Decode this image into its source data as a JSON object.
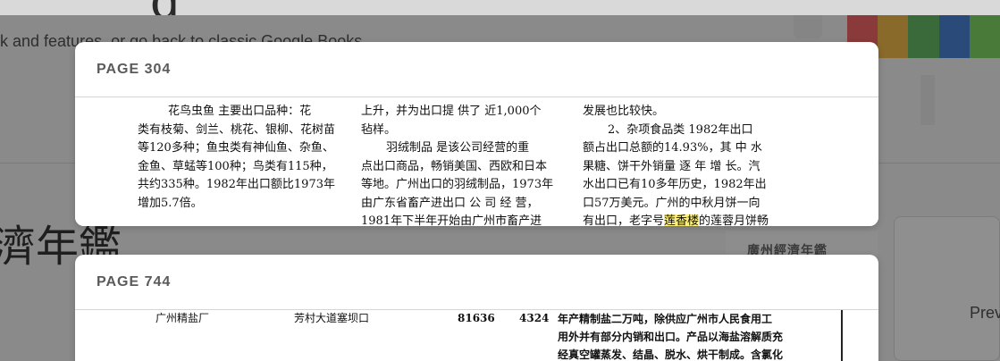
{
  "background": {
    "heading_fragment": "g",
    "link_text": "k and features, or go back to classic Google Books",
    "book_title_fragment": "濟年鑑",
    "book_cover_title": "廣州經濟年鑑",
    "preview_label": "Prev",
    "logo_colors": [
      "#8a3a3a",
      "#8a6a2a",
      "#3a6a3a",
      "#2a4a7a",
      "#4a7a3a"
    ]
  },
  "results": [
    {
      "page_label": "PAGE 304",
      "col_a": [
        "花鸟虫鱼  主要出口品种：花",
        "类有枝菊、剑兰、桃花、银柳、花树苗",
        "等120多种；鱼虫类有神仙鱼、杂鱼、",
        "金鱼、草蜢等100种；鸟类有115种，",
        "共约335种。1982年出口额比1973年",
        "增加5.7倍。"
      ],
      "col_b": [
        "上升，并为出口提 供了 近1,000个",
        "毡样。",
        "羽绒制品  是该公司经营的重",
        "点出口商品，畅销美国、西欧和日本",
        "等地。广州出口的羽绒制品，1973年",
        "由广东省畜产进出口 公 司 经 营，",
        "1981年下半年开始由广州市畜产进"
      ],
      "col_c": [
        "发展也比较快。",
        "2、杂项食品类  1982年出口",
        "额占出口总额的14.93%，其 中 水",
        "果糖、饼干外销量 逐 年 增 长。汽",
        "水出口已有10多年历史，1982年出",
        "口57万美元。广州的中秋月饼一向",
        "有出口，老字号",
        "莲香楼",
        "的莲蓉月饼畅"
      ]
    },
    {
      "page_label": "PAGE 744",
      "name": "广州精盐厂",
      "address": "芳村大道塞坝口",
      "phone": "81636",
      "code": "4324",
      "desc": [
        "年产精制盐二万吨，除供应广州市人民食用工",
        "用外并有部分内销和出口。产品以海盐溶解质充",
        "经真空罐蒸发、结晶、脱水、烘干制成。含氯化"
      ]
    }
  ]
}
